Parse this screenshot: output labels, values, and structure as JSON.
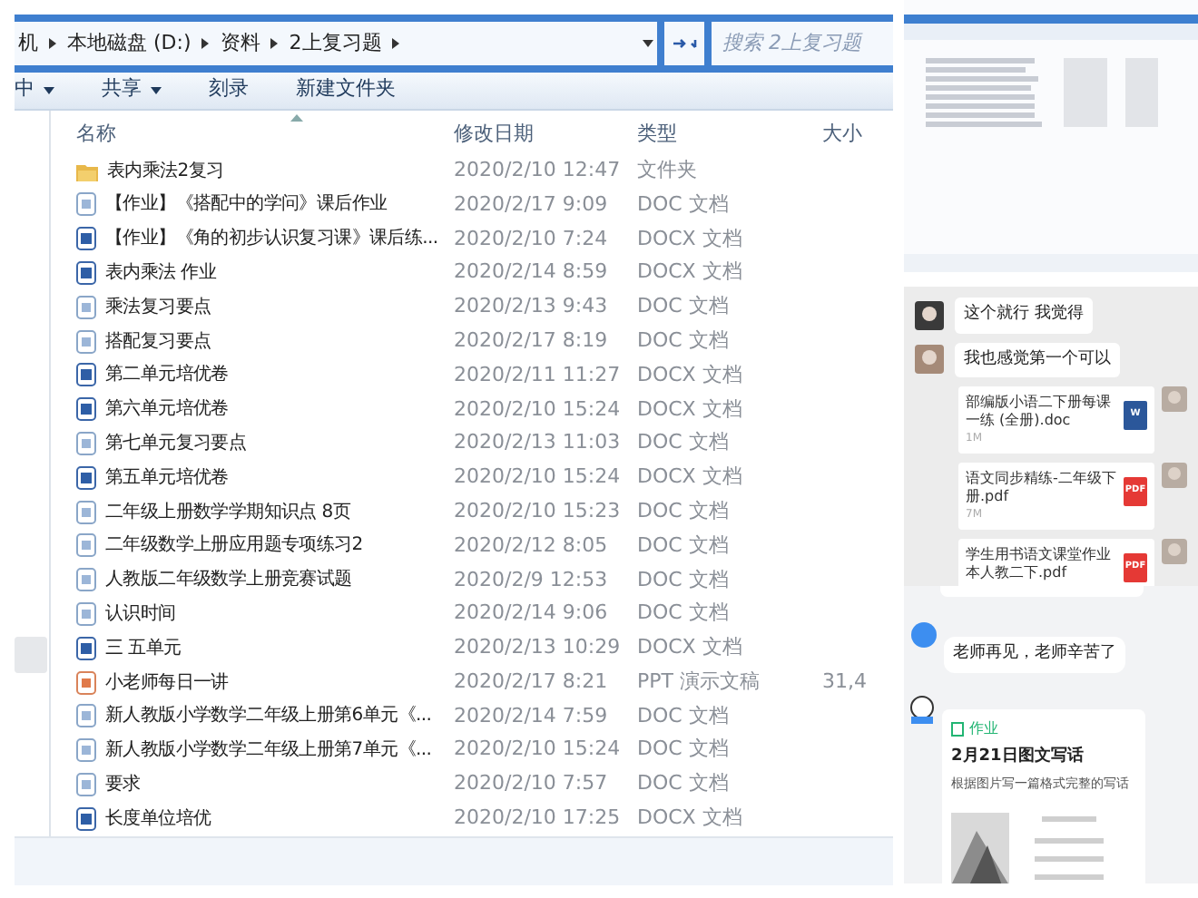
{
  "explorer": {
    "breadcrumb": [
      "机",
      "本地磁盘 (D:)",
      "资料",
      "2上复习题"
    ],
    "search": {
      "placeholder": "搜索 2上复习题"
    },
    "toolbar": [
      "中",
      "共享",
      "刻录",
      "新建文件夹"
    ],
    "columns": [
      "名称",
      "修改日期",
      "类型",
      "大小"
    ],
    "rows": [
      {
        "kind": "folder",
        "name": "表内乘法2复习",
        "date": "2020/2/10 12:47",
        "type": "文件夹"
      },
      {
        "kind": "doc",
        "name": "【作业】《搭配中的学问》课后作业",
        "date": "2020/2/17 9:09",
        "type": "DOC 文档"
      },
      {
        "kind": "docx",
        "name": "【作业】《角的初步认识复习课》课后练...",
        "date": "2020/2/10 7:24",
        "type": "DOCX 文档"
      },
      {
        "kind": "docx",
        "name": "表内乘法 作业",
        "date": "2020/2/14 8:59",
        "type": "DOCX 文档"
      },
      {
        "kind": "doc",
        "name": "乘法复习要点",
        "date": "2020/2/13 9:43",
        "type": "DOC 文档"
      },
      {
        "kind": "doc",
        "name": "搭配复习要点",
        "date": "2020/2/17 8:19",
        "type": "DOC 文档"
      },
      {
        "kind": "docx",
        "name": "第二单元培优卷",
        "date": "2020/2/11 11:27",
        "type": "DOCX 文档"
      },
      {
        "kind": "docx",
        "name": "第六单元培优卷",
        "date": "2020/2/10 15:24",
        "type": "DOCX 文档"
      },
      {
        "kind": "doc",
        "name": "第七单元复习要点",
        "date": "2020/2/13 11:03",
        "type": "DOC 文档"
      },
      {
        "kind": "docx",
        "name": "第五单元培优卷",
        "date": "2020/2/10 15:24",
        "type": "DOCX 文档"
      },
      {
        "kind": "doc",
        "name": "二年级上册数学学期知识点 8页",
        "date": "2020/2/10 15:23",
        "type": "DOC 文档"
      },
      {
        "kind": "doc",
        "name": "二年级数学上册应用题专项练习2",
        "date": "2020/2/12 8:05",
        "type": "DOC 文档"
      },
      {
        "kind": "doc",
        "name": "人教版二年级数学上册竞赛试题",
        "date": "2020/2/9 12:53",
        "type": "DOC 文档"
      },
      {
        "kind": "doc",
        "name": "认识时间",
        "date": "2020/2/14 9:06",
        "type": "DOC 文档"
      },
      {
        "kind": "docx",
        "name": "三 五单元",
        "date": "2020/2/13 10:29",
        "type": "DOCX 文档"
      },
      {
        "kind": "ppt",
        "name": "小老师每日一讲",
        "date": "2020/2/17 8:21",
        "type": "PPT 演示文稿",
        "size": "31,4"
      },
      {
        "kind": "doc",
        "name": "新人教版小学数学二年级上册第6单元《...",
        "date": "2020/2/14 7:59",
        "type": "DOC 文档"
      },
      {
        "kind": "doc",
        "name": "新人教版小学数学二年级上册第7单元《...",
        "date": "2020/2/10 15:24",
        "type": "DOC 文档"
      },
      {
        "kind": "doc",
        "name": "要求",
        "date": "2020/2/10 7:57",
        "type": "DOC 文档"
      },
      {
        "kind": "docx",
        "name": "长度单位培优",
        "date": "2020/2/10 17:25",
        "type": "DOCX 文档"
      }
    ]
  },
  "chat": {
    "messages": [
      {
        "kind": "text",
        "text": "这个就行 我觉得"
      },
      {
        "kind": "text",
        "text": "我也感觉第一个可以"
      },
      {
        "kind": "file",
        "name": "部编版小语二下册每课一练 (全册).doc",
        "size": "1M",
        "badge": "W",
        "color": "#2b579a"
      },
      {
        "kind": "file",
        "name": "语文同步精练-二年级下册.pdf",
        "size": "7M",
        "badge": "PDF",
        "color": "#e53935"
      },
      {
        "kind": "file",
        "name": "学生用书语文课堂作业本人教二下.pdf",
        "badge": "PDF",
        "color": "#e53935"
      }
    ]
  },
  "class_chat": {
    "message": "老师再见，老师辛苦了",
    "card": {
      "tag": "作业",
      "title": "2月21日图文写话",
      "description": "根据图片写一篇格式完整的写话"
    }
  }
}
